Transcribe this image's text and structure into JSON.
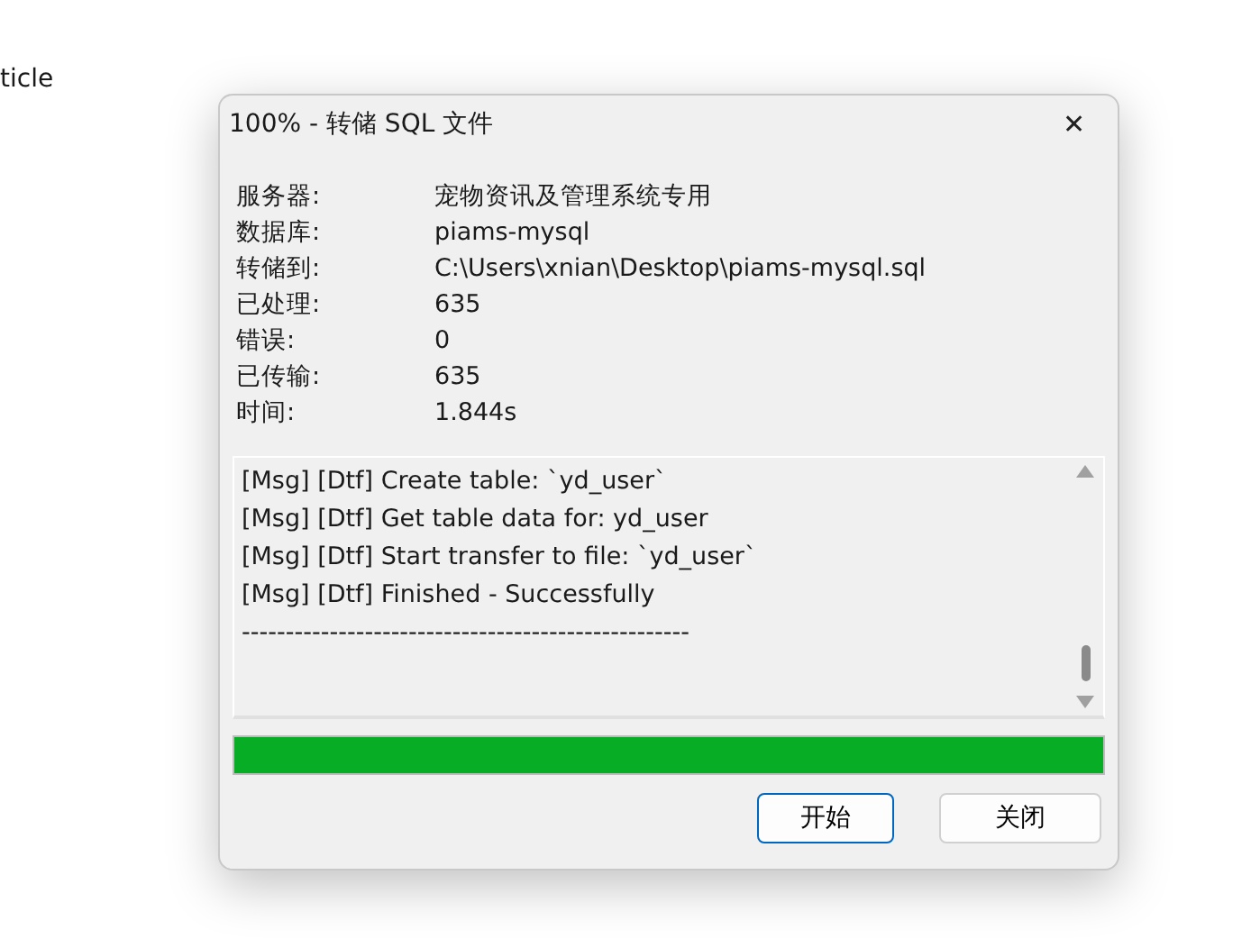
{
  "background_text": "ticle",
  "window": {
    "title": "100% - 转储 SQL 文件",
    "close": "✕"
  },
  "info": [
    {
      "label": "服务器:",
      "value": "宠物资讯及管理系统专用"
    },
    {
      "label": "数据库:",
      "value": "piams-mysql"
    },
    {
      "label": "转储到:",
      "value": "C:\\Users\\xnian\\Desktop\\piams-mysql.sql"
    },
    {
      "label": "已处理:",
      "value": "635"
    },
    {
      "label": "错误:",
      "value": "0"
    },
    {
      "label": "已传输:",
      "value": "635"
    },
    {
      "label": "时间:",
      "value": "1.844s"
    }
  ],
  "log": [
    "[Msg] [Dtf] Create table: `yd_user`",
    "[Msg] [Dtf] Get table data for: yd_user",
    "[Msg] [Dtf] Start transfer to file: `yd_user`",
    "[Msg] [Dtf] Finished - Successfully",
    "---------------------------------------------------"
  ],
  "progress": {
    "level": 1
  },
  "buttons": [
    {
      "label": "开始",
      "selected": true
    },
    {
      "label": "关闭",
      "selected": false
    }
  ]
}
